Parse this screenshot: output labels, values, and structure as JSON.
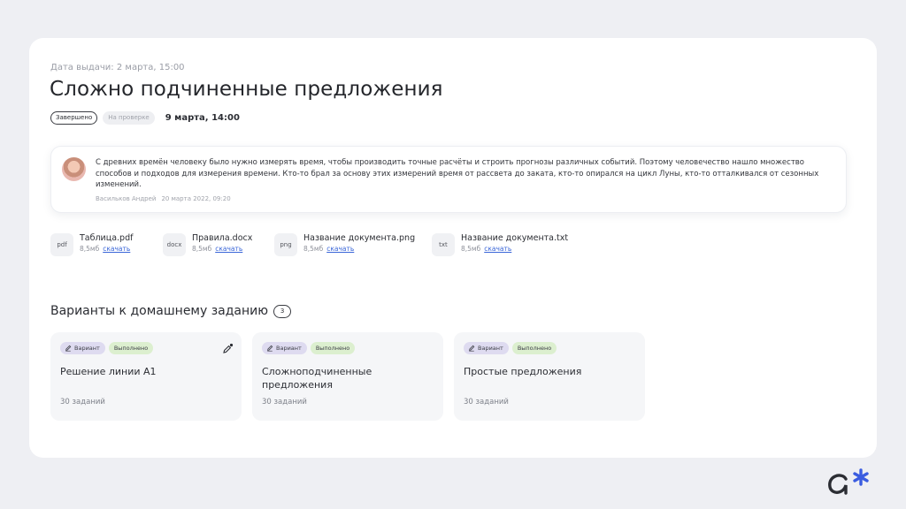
{
  "header": {
    "issue_date": "Дата выдачи: 2 марта, 15:00",
    "title": "Сложно подчиненные предложения",
    "status_done": "Завершено",
    "status_review": "На проверке",
    "deadline": "9 марта, 14:00"
  },
  "comment": {
    "text": "С древних времён человеку было нужно измерять время, чтобы производить точные расчёты и строить прогнозы различных событий. Поэтому человечество нашло множество способов и подходов для измерения времени. Кто-то брал за основу этих измерений время от рассвета до заката, кто-то опирался на цикл Луны, кто-то отталкивался от сезонных изменений.",
    "author": "Васильков Андрей",
    "date": "20 марта 2022, 09:20"
  },
  "files": [
    {
      "ext": "pdf",
      "name": "Таблица.pdf",
      "size": "8,5мб",
      "link": "скачать"
    },
    {
      "ext": "docx",
      "name": "Правила.docx",
      "size": "8,5мб",
      "link": "скачать"
    },
    {
      "ext": "png",
      "name": "Название документа.png",
      "size": "8,5мб",
      "link": "скачать"
    },
    {
      "ext": "txt",
      "name": "Название документа.txt",
      "size": "8,5мб",
      "link": "скачать"
    }
  ],
  "variants_section": {
    "title": "Варианты к домашнему заданию",
    "count": "3"
  },
  "variants": [
    {
      "tag": "Вариант",
      "status": "Выполнено",
      "title": "Решение линии А1",
      "count": "30 заданий"
    },
    {
      "tag": "Вариант",
      "status": "Выполнено",
      "title": "Сложноподчиненные предложения",
      "count": "30 заданий"
    },
    {
      "tag": "Вариант",
      "status": "Выполнено",
      "title": "Простые предложения",
      "count": "30 заданий"
    }
  ],
  "colors": {
    "link": "#3a66d8",
    "variant_tag": "#dedbf0",
    "done_tag": "#dcefcf",
    "logo": "#3a5ce0"
  },
  "icons": {
    "variant_tag_icon": "pencil-icon",
    "card_action_icon": "edit-notification-icon",
    "logo": "brand-logo"
  }
}
